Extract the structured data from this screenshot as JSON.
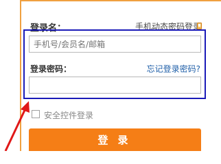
{
  "login_form": {
    "username_label": "登录名：",
    "mobile_login_link": "手机动态密码登录",
    "username_placeholder": "手机号/会员名/邮箱",
    "password_label": "登录密码：",
    "forgot_password_link": "忘记登录密码?",
    "security_control_label": "安全控件登录",
    "security_control_checked": false,
    "login_button_label": "登录"
  },
  "colors": {
    "accent_orange": "#f57e16",
    "highlight_frame": "#1a1ab8",
    "annotation_arrow": "#e01818",
    "link_blue": "#1f5fa8"
  },
  "icons": {
    "mobile": "mobile-phone-icon"
  }
}
